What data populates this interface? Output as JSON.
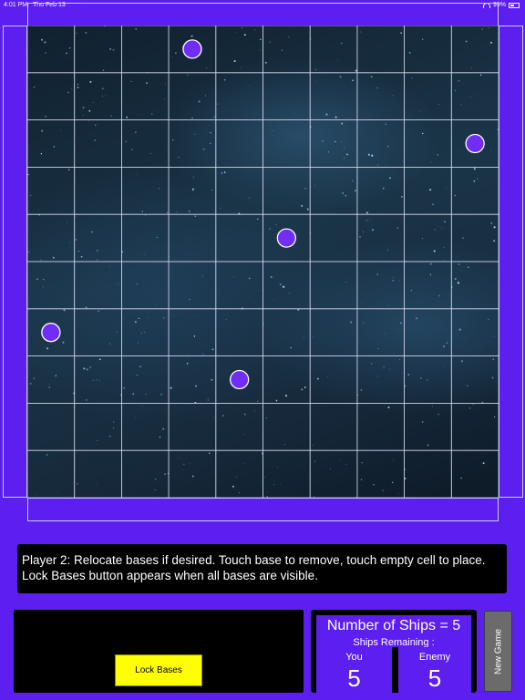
{
  "status_bar": {
    "time": "4:01 PM",
    "date": "Thu Feb 13",
    "battery": "99%"
  },
  "board": {
    "rows": 10,
    "cols": 10,
    "bases": [
      {
        "row": 0,
        "col": 3
      },
      {
        "row": 2,
        "col": 9
      },
      {
        "row": 4,
        "col": 5
      },
      {
        "row": 6,
        "col": 0
      },
      {
        "row": 7,
        "col": 4
      }
    ],
    "base_color": "#6f2df5",
    "grid_color": "#d8dcf0"
  },
  "message": {
    "line1": "Player 2: Relocate bases if desired. Touch base to remove, touch empty cell to place.",
    "line2": "Lock Bases button appears when all bases are visible."
  },
  "controls": {
    "lock_bases_label": "Lock Bases",
    "new_game_label": "New Game"
  },
  "ships": {
    "number_label": "Number of Ships = 5",
    "remaining_label": "Ships Remaining :",
    "you_label": "You",
    "enemy_label": "Enemy",
    "you_value": "5",
    "enemy_value": "5"
  },
  "colors": {
    "background": "#5c1ff0",
    "lock_button": "#ffff00",
    "new_game_button": "#6b6b6b"
  }
}
